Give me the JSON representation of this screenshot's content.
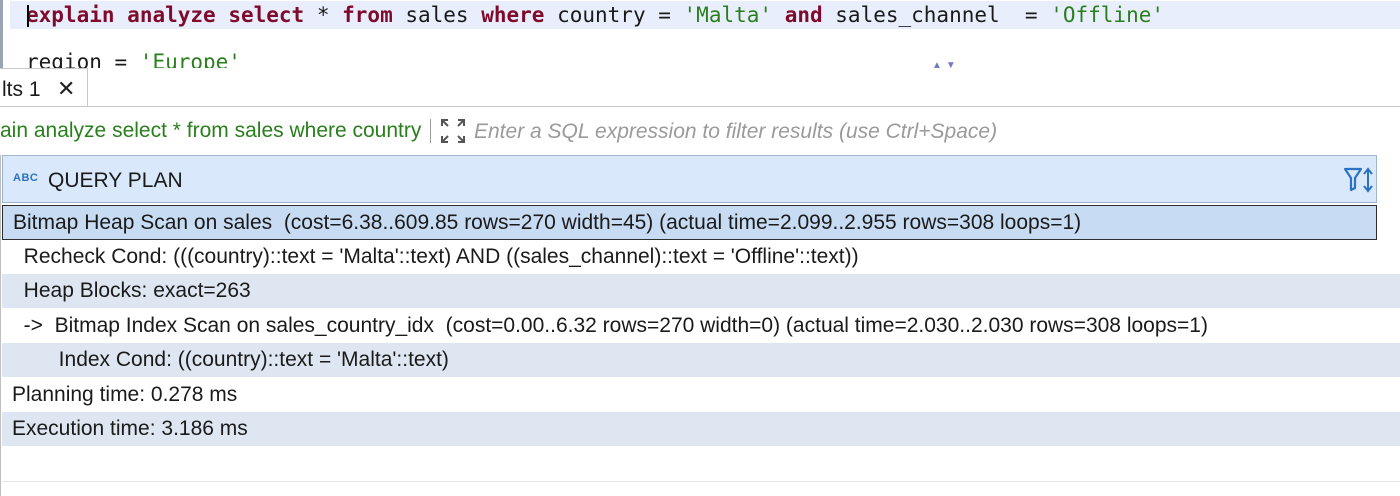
{
  "editor": {
    "line1": {
      "kw_explain": "explain",
      "kw_analyze": "analyze",
      "kw_select": "select",
      "star": " * ",
      "kw_from": "from",
      "table": " sales ",
      "kw_where": "where",
      "col_country": " country = ",
      "val_malta": "'Malta'",
      "kw_and": "and",
      "col_channel": " sales_channel  = ",
      "val_offline": "'Offline'"
    },
    "line2": {
      "col_region": "region = ",
      "val_europe": "'Europe'"
    }
  },
  "results_tab": {
    "label": "lts 1",
    "close_glyph": "✕"
  },
  "filter": {
    "query_preview": "ain analyze select * from sales where country = 'Malta' and sales_channel = 'Offline'",
    "placeholder": "Enter a SQL expression to filter results (use Ctrl+Space)"
  },
  "grid": {
    "column_type_badge": "ABC",
    "column_header": "QUERY PLAN",
    "rows": [
      "Bitmap Heap Scan on sales  (cost=6.38..609.85 rows=270 width=45) (actual time=2.099..2.955 rows=308 loops=1)",
      "  Recheck Cond: (((country)::text = 'Malta'::text) AND ((sales_channel)::text = 'Offline'::text))",
      "  Heap Blocks: exact=263",
      "  ->  Bitmap Index Scan on sales_country_idx  (cost=0.00..6.32 rows=270 width=0) (actual time=2.030..2.030 rows=308 loops=1)",
      "        Index Cond: ((country)::text = 'Malta'::text)",
      "Planning time: 0.278 ms",
      "Execution time: 3.186 ms"
    ]
  },
  "colors": {
    "keyword": "#7f0a2b",
    "string": "#2a7f1d",
    "header_bg": "#d9e8fb",
    "row_alt_bg": "#dde6f1",
    "selected_bg": "#c7dbf2",
    "icon_blue": "#2b72c2"
  }
}
